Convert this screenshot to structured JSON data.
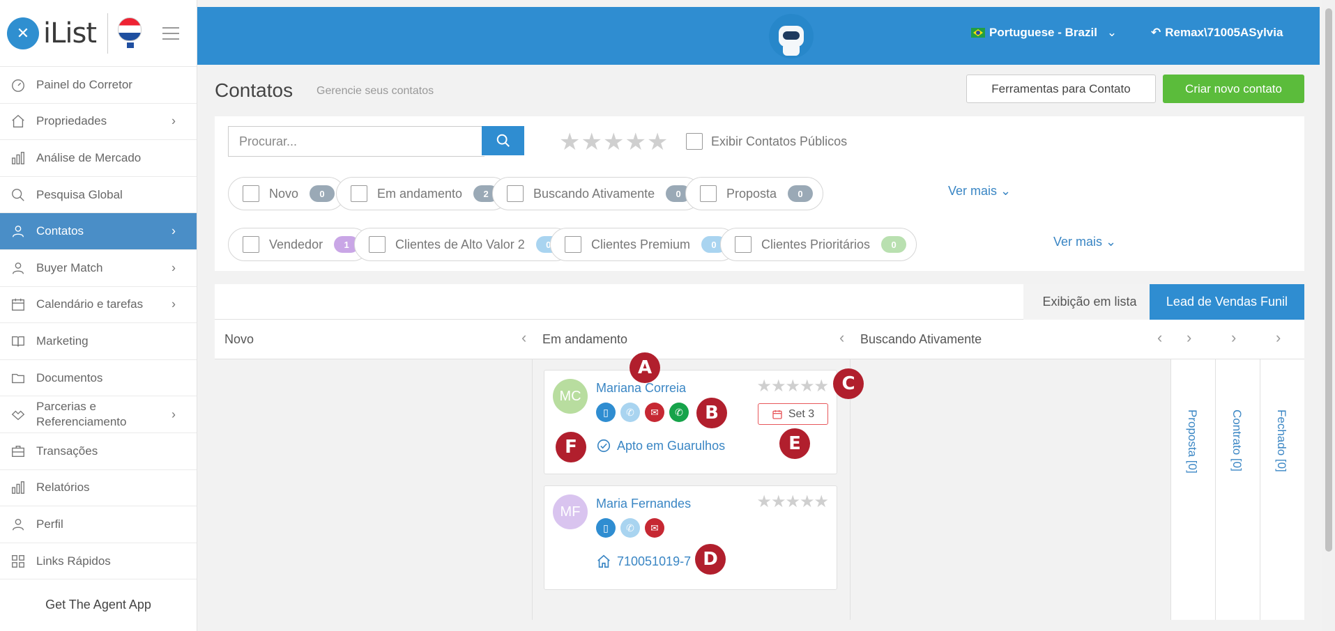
{
  "brand": {
    "name": "iList"
  },
  "sidebar": {
    "items": [
      {
        "label": "Painel do Corretor",
        "icon": "gauge-icon",
        "chevron": false,
        "active": false
      },
      {
        "label": "Propriedades",
        "icon": "home-icon",
        "chevron": true,
        "active": false
      },
      {
        "label": "Análise de Mercado",
        "icon": "bar-chart-icon",
        "chevron": false,
        "active": false
      },
      {
        "label": "Pesquisa Global",
        "icon": "search-icon",
        "chevron": false,
        "active": false
      },
      {
        "label": "Contatos",
        "icon": "contacts-icon",
        "chevron": true,
        "active": true
      },
      {
        "label": "Buyer Match",
        "icon": "user-icon",
        "chevron": true,
        "active": false
      },
      {
        "label": "Calendário e tarefas",
        "icon": "calendar-icon",
        "chevron": true,
        "active": false
      },
      {
        "label": "Marketing",
        "icon": "book-icon",
        "chevron": false,
        "active": false
      },
      {
        "label": "Documentos",
        "icon": "folder-icon",
        "chevron": false,
        "active": false
      },
      {
        "label": "Parcerias e Referenciamento",
        "icon": "handshake-icon",
        "chevron": true,
        "active": false
      },
      {
        "label": "Transações",
        "icon": "briefcase-icon",
        "chevron": false,
        "active": false
      },
      {
        "label": "Relatórios",
        "icon": "bar-chart-icon",
        "chevron": false,
        "active": false
      },
      {
        "label": "Perfil",
        "icon": "user-icon",
        "chevron": false,
        "active": false
      },
      {
        "label": "Links Rápidos",
        "icon": "links-icon",
        "chevron": false,
        "active": false
      }
    ],
    "agent_app": "Get The Agent App"
  },
  "header": {
    "language": "Portuguese - Brazil",
    "user": "Remax\\71005ASylvia"
  },
  "page": {
    "title": "Contatos",
    "subtitle": "Gerencie seus contatos",
    "tools_button": "Ferramentas para Contato",
    "create_button": "Criar novo contato"
  },
  "filters": {
    "search_placeholder": "Procurar...",
    "public_contacts": "Exibir Contatos Públicos",
    "row1": [
      {
        "label": "Novo",
        "count": "0",
        "color": "#9aa9b6"
      },
      {
        "label": "Em andamento",
        "count": "2",
        "color": "#9aa9b6"
      },
      {
        "label": "Buscando Ativamente",
        "count": "0",
        "color": "#9aa9b6"
      },
      {
        "label": "Proposta",
        "count": "0",
        "color": "#9aa9b6"
      }
    ],
    "row2": [
      {
        "label": "Vendedor",
        "count": "1",
        "color": "#c9a6e6"
      },
      {
        "label": "Clientes de Alto Valor 2",
        "count": "0",
        "color": "#a9d4f0"
      },
      {
        "label": "Clientes Premium",
        "count": "0",
        "color": "#a9d4f0"
      },
      {
        "label": "Clientes Prioritários",
        "count": "0",
        "color": "#b9e0b0"
      }
    ],
    "ver_mais": "Ver mais"
  },
  "board": {
    "tab_list": "Exibição em lista",
    "tab_funnel": "Lead de Vendas Funil",
    "columns": [
      "Novo",
      "Em andamento",
      "Buscando Ativamente"
    ],
    "vertical_columns": [
      "Proposta [0]",
      "Contrato [0]",
      "Fechado [0]"
    ]
  },
  "cards": [
    {
      "initials": "MC",
      "name": "Mariana Correia",
      "avatar_color": "#b8dd9f",
      "icons": [
        "mobile-icon",
        "phone-icon",
        "email-icon",
        "whatsapp-icon"
      ],
      "date": "Set 3",
      "note": "Apto em Guarulhos"
    },
    {
      "initials": "MF",
      "name": "Maria Fernandes",
      "avatar_color": "#d9c4ef",
      "icons": [
        "mobile-icon",
        "phone-icon",
        "email-icon"
      ],
      "property": "710051019-7"
    }
  ],
  "markers": [
    "A",
    "B",
    "C",
    "D",
    "E",
    "F"
  ],
  "colors": {
    "primary": "#2f8dd1",
    "green": "#5bbc3b",
    "marker": "#b11f2d",
    "sidebar_active": "#4a8ec7"
  }
}
